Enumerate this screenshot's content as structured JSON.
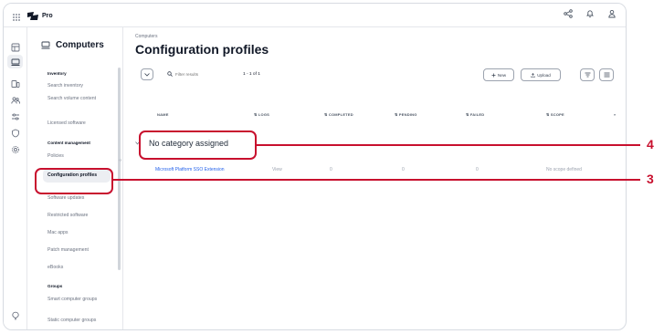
{
  "topbar": {
    "app_name": "Pro",
    "icons": [
      "apps-grid-icon",
      "share-icon",
      "notification-icon",
      "user-icon"
    ]
  },
  "rail": {
    "icons": [
      "dashboard-icon",
      "computers-icon",
      "devices-icon",
      "users-icon",
      "settings-sliders-icon",
      "shield-icon",
      "gear-icon",
      "help-icon"
    ]
  },
  "sidebar": {
    "title": "Computers",
    "sections": [
      {
        "label": "Inventory",
        "items": [
          "Search inventory",
          "Search volume content",
          "Licensed software"
        ]
      },
      {
        "label": "Content management",
        "items": [
          "Policies",
          "Configuration profiles",
          "Software updates",
          "Restricted software",
          "Mac apps",
          "Patch management",
          "eBooks"
        ]
      },
      {
        "label": "Groups",
        "items": [
          "Smart computer groups",
          "Static computer groups"
        ]
      }
    ],
    "active_item": "Configuration profiles"
  },
  "main": {
    "breadcrumb": "Computers",
    "title": "Configuration profiles",
    "toolbar": {
      "search_placeholder": "Filter results",
      "count": "1 - 1 of 1",
      "new_label": "New",
      "upload_label": "Upload"
    },
    "columns": [
      "NAME",
      "LOGS",
      "COMPLETED",
      "PENDING",
      "FAILED",
      "SCOPE"
    ],
    "group_label": "No category assigned",
    "rows": [
      {
        "name": "Microsoft Platform SSO Extension",
        "logs": "View",
        "completed": "0",
        "pending": "0",
        "failed": "0",
        "scope": "No scope defined"
      }
    ]
  },
  "callouts": [
    {
      "number": "4",
      "target": "profile-link"
    },
    {
      "number": "3",
      "target": "configuration-profiles-item"
    }
  ],
  "colors": {
    "accent_red": "#c8102e",
    "link_blue": "#2563eb",
    "active_bg": "#eceef2"
  }
}
